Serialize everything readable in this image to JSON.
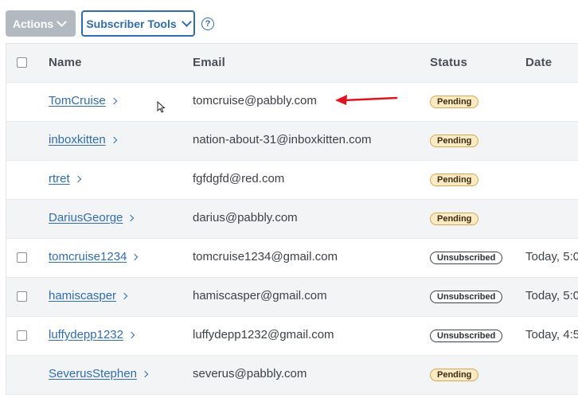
{
  "toolbar": {
    "actions_label": "Actions",
    "tools_label": "Subscriber Tools",
    "help_label": "?"
  },
  "table": {
    "columns": [
      "Name",
      "Email",
      "Status",
      "Date"
    ],
    "rows": [
      {
        "name": "TomCruise",
        "email": "tomcruise@pabbly.com",
        "status": "Pending",
        "date": ""
      },
      {
        "name": "inboxkitten",
        "email": "nation-about-31@inboxkitten.com",
        "status": "Pending",
        "date": ""
      },
      {
        "name": "rtret",
        "email": "fgfdgfd@red.com",
        "status": "Pending",
        "date": ""
      },
      {
        "name": "DariusGeorge",
        "email": "darius@pabbly.com",
        "status": "Pending",
        "date": ""
      },
      {
        "name": "tomcruise1234",
        "email": "tomcruise1234@gmail.com",
        "status": "Unsubscribed",
        "date": "Today, 5:0"
      },
      {
        "name": "hamiscasper",
        "email": "hamiscasper@gmail.com",
        "status": "Unsubscribed",
        "date": "Today, 5:0"
      },
      {
        "name": "luffydepp1232",
        "email": "luffydepp1232@gmail.com",
        "status": "Unsubscribed",
        "date": "Today, 4:5"
      },
      {
        "name": "SeverusStephen",
        "email": "severus@pabbly.com",
        "status": "Pending",
        "date": ""
      }
    ]
  },
  "colors": {
    "link": "#2f6db0",
    "pending_bg": "#fbeac3",
    "annotation_arrow": "#e0141e"
  }
}
